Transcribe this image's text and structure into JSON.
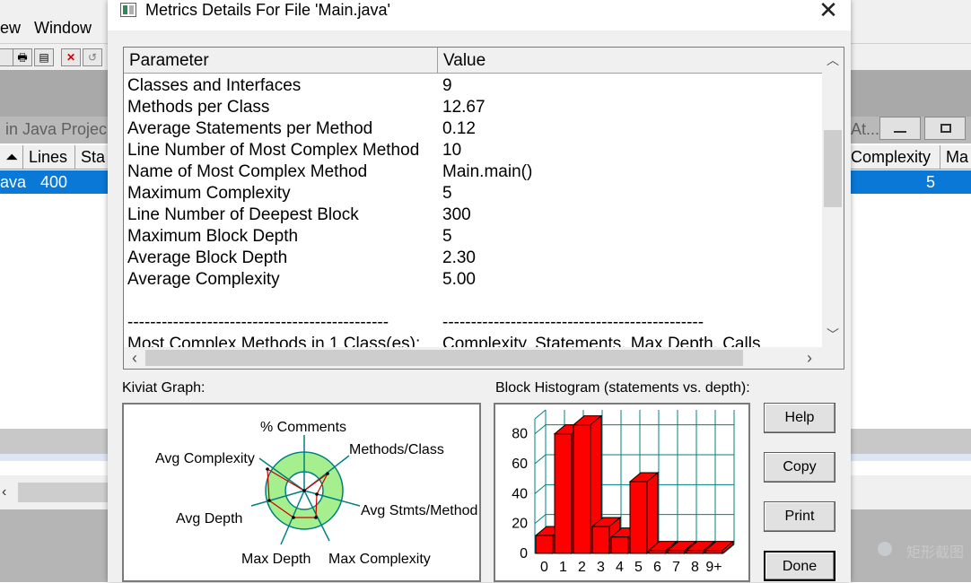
{
  "background_app": {
    "menu": [
      "ew",
      "Window"
    ],
    "title_partial": "in Java Projec",
    "title_partial_right": "At...",
    "columns": [
      "Lines",
      "Sta",
      "Complexity",
      "Ma"
    ],
    "selected_row": {
      "name": "ava",
      "lines": "400",
      "max_complexity": "5"
    },
    "watermark": "矩形截图"
  },
  "dialog": {
    "title": "Metrics Details For File 'Main.java'",
    "close_glyph": "✕",
    "table": {
      "headers": [
        "Parameter",
        "Value"
      ],
      "rows": [
        {
          "param": "Classes and Interfaces",
          "value": "9"
        },
        {
          "param": "Methods per Class",
          "value": "12.67"
        },
        {
          "param": "Average Statements per Method",
          "value": "0.12"
        },
        {
          "param": "Line Number of Most Complex Method",
          "value": "10"
        },
        {
          "param": "Name of Most Complex Method",
          "value": "Main.main()"
        },
        {
          "param": "Maximum Complexity",
          "value": "5"
        },
        {
          "param": "Line Number of Deepest Block",
          "value": "300"
        },
        {
          "param": "Maximum Block Depth",
          "value": "5"
        },
        {
          "param": "Average Block Depth",
          "value": "2.30"
        },
        {
          "param": "Average Complexity",
          "value": "5.00"
        },
        {
          "param": "",
          "value": ""
        },
        {
          "param": "----------------------------------------------",
          "value": "----------------------------------------------"
        },
        {
          "param": "Most Complex Methods in 1 Class(es):",
          "value": "Complexity, Statements, Max Depth, Calls"
        }
      ]
    },
    "kiviat": {
      "label": "Kiviat Graph:",
      "axes": [
        "% Comments",
        "Methods/Class",
        "Avg Stmts/Method",
        "Max Complexity",
        "Max Depth",
        "Avg Depth",
        "Avg Complexity"
      ]
    },
    "histogram": {
      "label": "Block Histogram (statements vs. depth):"
    },
    "buttons": {
      "help": "Help",
      "copy": "Copy",
      "print": "Print",
      "done": "Done"
    },
    "colors": {
      "kiviat_ring": "#a6ef8f",
      "bar": "#ff0000",
      "grid": "#008080"
    }
  },
  "chart_data": {
    "type": "bar",
    "categories": [
      "0",
      "1",
      "2",
      "3",
      "4",
      "5",
      "6",
      "7",
      "8",
      "9+"
    ],
    "values": [
      12,
      80,
      86,
      18,
      11,
      48,
      2,
      2,
      2,
      2
    ],
    "ylim": [
      0,
      90
    ],
    "yticks": [
      0,
      20,
      40,
      60,
      80
    ],
    "grid": true
  }
}
